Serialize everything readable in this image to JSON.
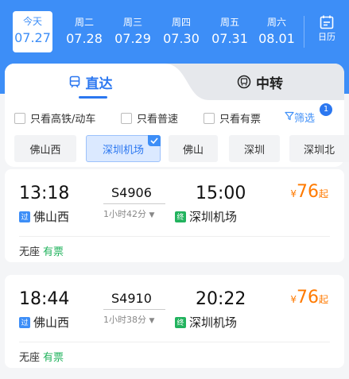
{
  "dates": [
    {
      "weekday": "今天",
      "date": "07.27",
      "active": true
    },
    {
      "weekday": "周二",
      "date": "07.28",
      "active": false
    },
    {
      "weekday": "周三",
      "date": "07.29",
      "active": false
    },
    {
      "weekday": "周四",
      "date": "07.30",
      "active": false
    },
    {
      "weekday": "周五",
      "date": "07.31",
      "active": false
    },
    {
      "weekday": "周六",
      "date": "08.01",
      "active": false
    }
  ],
  "calendar_label": "日历",
  "tabs": {
    "direct": "直达",
    "transfer": "中转"
  },
  "filters": {
    "high_speed": "只看高铁/动车",
    "normal": "只看普速",
    "available": "只看有票",
    "filter_label": "筛选",
    "filter_badge": "1"
  },
  "stations": [
    {
      "name": "佛山西",
      "selected": false
    },
    {
      "name": "深圳机场",
      "selected": true
    },
    {
      "name": "佛山",
      "selected": false
    },
    {
      "name": "深圳",
      "selected": false
    },
    {
      "name": "深圳北",
      "selected": false
    }
  ],
  "trains": [
    {
      "depart_time": "13:18",
      "train_no": "S4906",
      "arrive_time": "15:00",
      "duration": "1小时42分",
      "from_tag": "过",
      "from_station": "佛山西",
      "to_tag": "终",
      "to_station": "深圳机场",
      "price_currency": "¥",
      "price": "76",
      "price_suffix": "起",
      "seat_type": "无座",
      "seat_status": "有票"
    },
    {
      "depart_time": "18:44",
      "train_no": "S4910",
      "arrive_time": "20:22",
      "duration": "1小时38分",
      "from_tag": "过",
      "from_station": "佛山西",
      "to_tag": "终",
      "to_station": "深圳机场",
      "price_currency": "¥",
      "price": "76",
      "price_suffix": "起",
      "seat_type": "无座",
      "seat_status": "有票"
    }
  ],
  "colors": {
    "header_blue": "#3d8ef7",
    "accent_blue": "#2b77f0",
    "price_orange": "#ff7a00",
    "available_green": "#22b35e"
  }
}
